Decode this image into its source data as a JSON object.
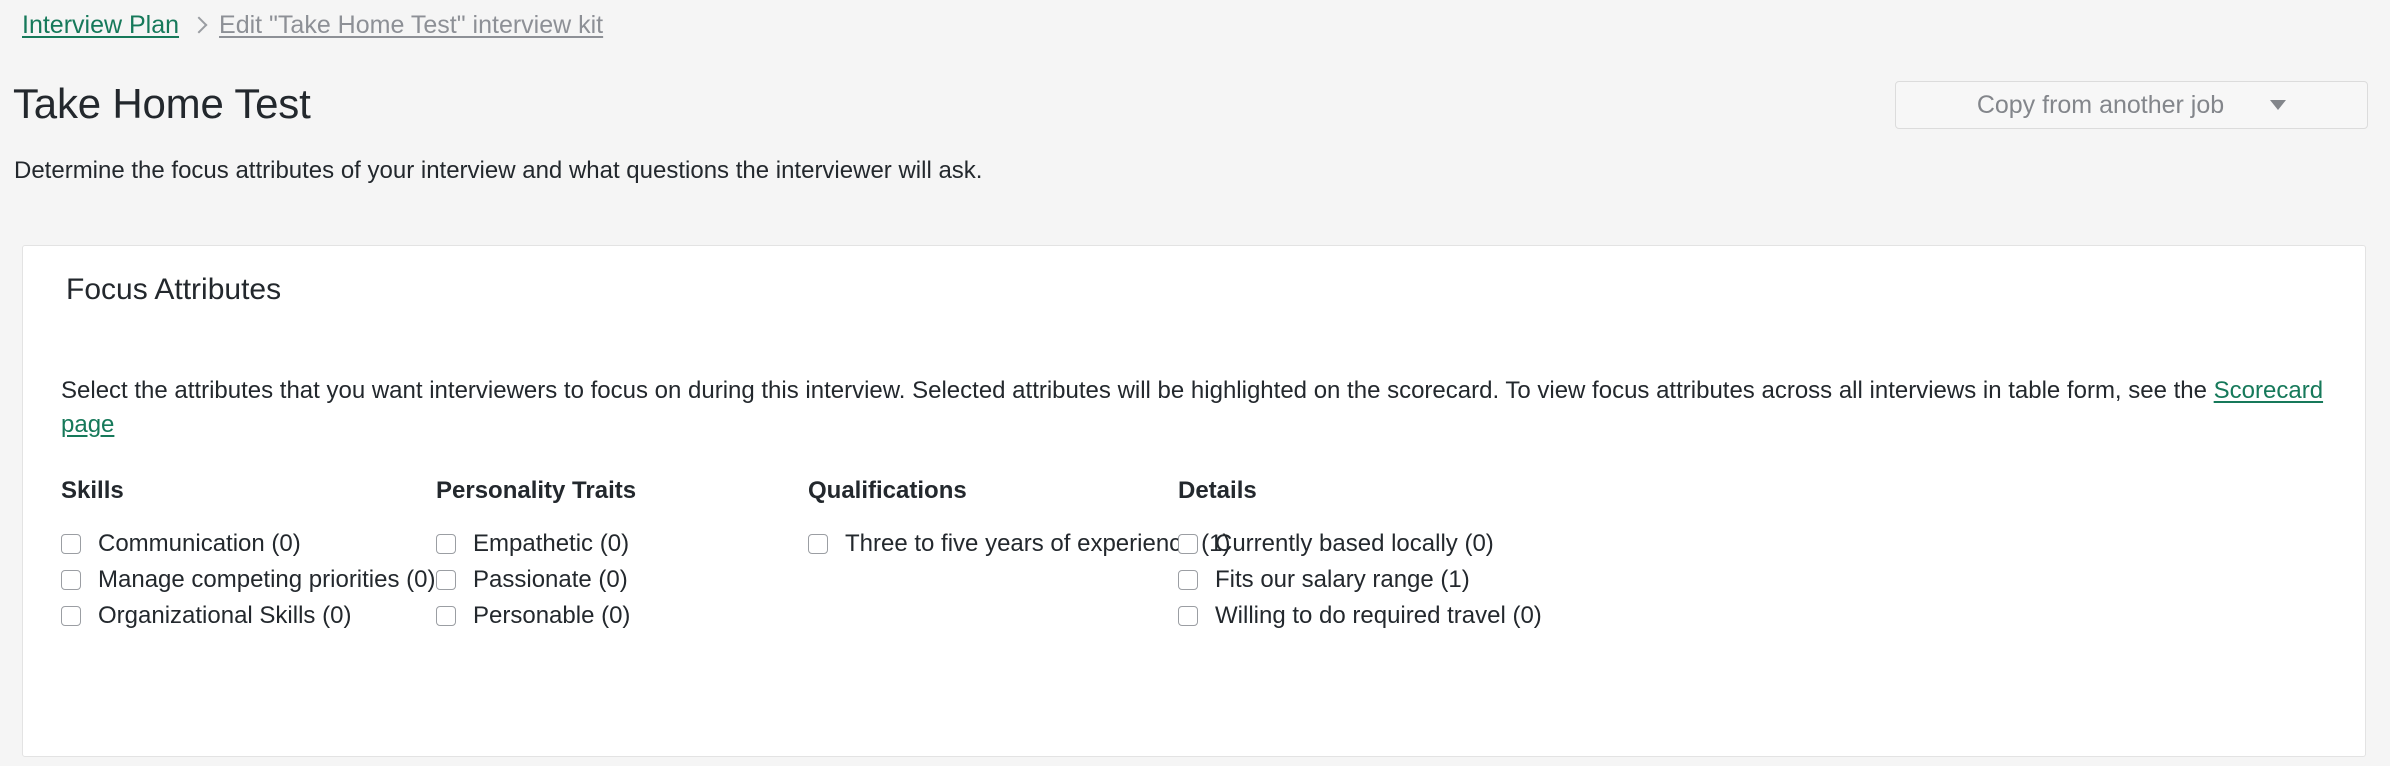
{
  "breadcrumb": {
    "parent_label": "Interview Plan",
    "separator_icon": "chevron-right-icon",
    "current_label": "Edit \"Take Home Test\" interview kit"
  },
  "header": {
    "title": "Take Home Test",
    "subtitle": "Determine the focus attributes of your interview and what questions the interviewer will ask.",
    "copy_button_label": "Copy from another job",
    "copy_button_icon": "caret-down-icon"
  },
  "card": {
    "title": "Focus Attributes",
    "description_before_link": "Select the attributes that you want interviewers to focus on during this interview. Selected attributes will be highlighted on the scorecard. To view focus attributes across all interviews in table form, see the",
    "description_link": "Scorecard page",
    "columns": [
      {
        "heading": "Skills",
        "options": [
          {
            "label": "Communication (0)",
            "checked": false
          },
          {
            "label": "Manage competing priorities (0)",
            "checked": false
          },
          {
            "label": "Organizational Skills (0)",
            "checked": false
          }
        ]
      },
      {
        "heading": "Personality Traits",
        "options": [
          {
            "label": "Empathetic (0)",
            "checked": false
          },
          {
            "label": "Passionate (0)",
            "checked": false
          },
          {
            "label": "Personable (0)",
            "checked": false
          }
        ]
      },
      {
        "heading": "Qualifications",
        "options": [
          {
            "label": "Three to five years of experience (1)",
            "checked": false
          }
        ]
      },
      {
        "heading": "Details",
        "options": [
          {
            "label": "Currently based locally (0)",
            "checked": false
          },
          {
            "label": "Fits our salary range (1)",
            "checked": false
          },
          {
            "label": "Willing to do required travel (0)",
            "checked": false
          }
        ]
      }
    ]
  },
  "colors": {
    "link_green": "#16795a",
    "page_background": "#f5f5f5",
    "card_background": "#ffffff",
    "card_border": "#e3e3e3",
    "muted_text": "#8d9096",
    "body_text": "#23282d"
  }
}
